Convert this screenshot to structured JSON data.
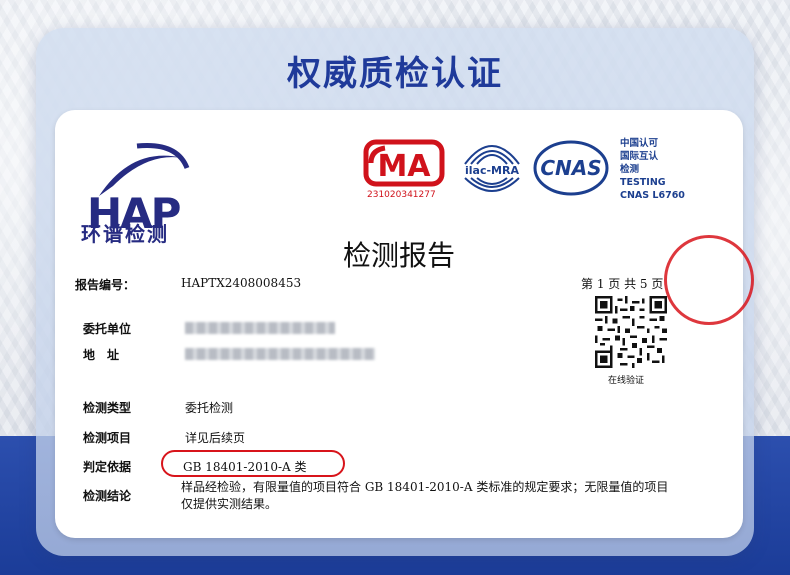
{
  "banner": {
    "title": "权威质检认证"
  },
  "logos": {
    "hap_logo_name": "环谱检测",
    "cma_number": "231020341277",
    "cnas_text": [
      "中国认可",
      "国际互认",
      "检测",
      "TESTING",
      "CNAS L6760"
    ]
  },
  "report": {
    "title": "检测报告",
    "number_label": "报告编号：",
    "number_value": "HAPTX2408008453",
    "page_info": "第 1 页 共 5 页",
    "client_label": "委托单位",
    "address_label": "地　址",
    "test_type_label": "检测类型",
    "test_type_value": "委托检测",
    "test_items_label": "检测项目",
    "test_items_value": "详见后续页",
    "basis_label": "判定依据",
    "basis_value": "GB 18401-2010-A 类",
    "conclusion_label": "检测结论",
    "conclusion_line1": "样品经检验，有限量值的项目符合 GB 18401-2010-A 类标准的规定要求；无限量值的项目",
    "conclusion_line2": "仅提供实测结果。",
    "qr_caption": "在线验证"
  },
  "colors": {
    "brand_blue": "#1f3a9a",
    "highlight_red": "#d8141b",
    "logo_purple": "#262b82"
  }
}
